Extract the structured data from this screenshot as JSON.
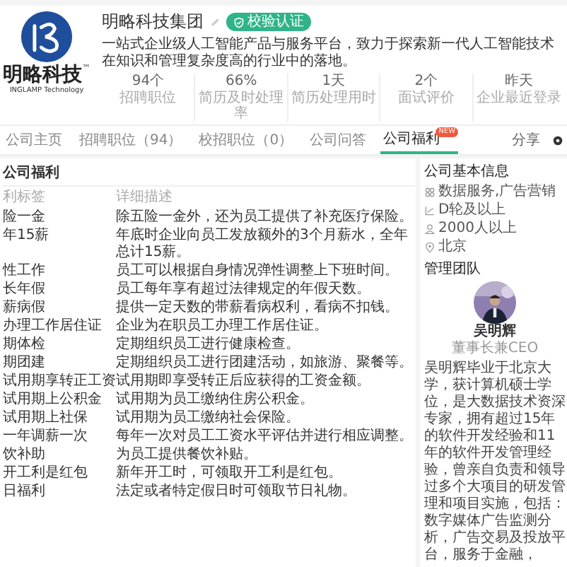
{
  "company": {
    "logo_text": "明略科技",
    "logo_mark": "™",
    "logo_subtext": "INGLAMP Technology",
    "name": "明略科技集团",
    "badge": "校验认证",
    "description": "一站式企业级人工智能产品与服务平台，致力于探索新一代人工智能技术在知识和管理复杂度高的行业中的落地。"
  },
  "stats": [
    {
      "value": "94个",
      "label": "招聘职位"
    },
    {
      "value": "66%",
      "label": "简历及时处理率"
    },
    {
      "value": "1天",
      "label": "简历处理用时"
    },
    {
      "value": "2个",
      "label": "面试评价"
    },
    {
      "value": "昨天",
      "label": "企业最近登录"
    }
  ],
  "tabs": [
    {
      "label": "公司主页",
      "selected": false
    },
    {
      "label": "招聘职位（94）",
      "selected": false
    },
    {
      "label": "校招职位（0）",
      "selected": false
    },
    {
      "label": "公司问答",
      "selected": false
    },
    {
      "label": "公司福利",
      "selected": true,
      "badge": "NEW"
    }
  ],
  "share": "分享",
  "benefits": {
    "title": "公司福利",
    "columns": [
      "利标签",
      "详细描述"
    ],
    "rows": [
      {
        "tag": "险一金",
        "description": "除五险一金外，还为员工提供了补充医疗保险。"
      },
      {
        "tag": "年15薪",
        "description": "年底时企业向员工发放额外的3个月薪水，全年总计15薪。"
      },
      {
        "tag": "性工作",
        "description": "员工可以根据自身情况弹性调整上下班时间。"
      },
      {
        "tag": "长年假",
        "description": "员工每年享有超过法律规定的年假天数。"
      },
      {
        "tag": "薪病假",
        "description": "提供一定天数的带薪看病权利，看病不扣钱。"
      },
      {
        "tag": "办理工作居住证",
        "description": "企业为在职员工办理工作居住证。"
      },
      {
        "tag": "期体检",
        "description": "定期组织员工进行健康检查。"
      },
      {
        "tag": "期团建",
        "description": "定期组织员工进行团建活动，如旅游、聚餐等。"
      },
      {
        "tag": "试用期享转正工资",
        "description": "试用期即享受转正后应获得的工资金额。"
      },
      {
        "tag": "试用期上公积金",
        "description": "试用期为员工缴纳住房公积金。"
      },
      {
        "tag": "试用期上社保",
        "description": "试用期为员工缴纳社会保险。"
      },
      {
        "tag": "一年调薪一次",
        "description": "每年一次对员工工资水平评估并进行相应调整。"
      },
      {
        "tag": "饮补助",
        "description": "为员工提供餐饮补贴。"
      },
      {
        "tag": "开工利是红包",
        "description": "新年开工时，可领取开工利是红包。"
      },
      {
        "tag": "日福利",
        "description": "法定或者特定假日时可领取节日礼物。"
      }
    ]
  },
  "info": {
    "title": "公司基本信息",
    "items": [
      {
        "kind": "industry",
        "text": "数据服务,广告营销"
      },
      {
        "kind": "funding",
        "text": "D轮及以上"
      },
      {
        "kind": "size",
        "text": "2000人以上"
      },
      {
        "kind": "location",
        "text": "北京"
      }
    ]
  },
  "team": {
    "title": "管理团队",
    "members": [
      {
        "name": "吴明辉",
        "title": "董事长兼CEO",
        "bio": "吴明辉毕业于北京大学，获计算机硕士学位，是大数据技术资深专家，拥有超过15年的软件开发经验和11年的软件开发管理经验，曾亲自负责和领导过多个大项目的研发管理和项目实施，包括：数字媒体广告监测分析，广告交易及投放平台，服务于金融，"
      }
    ]
  }
}
